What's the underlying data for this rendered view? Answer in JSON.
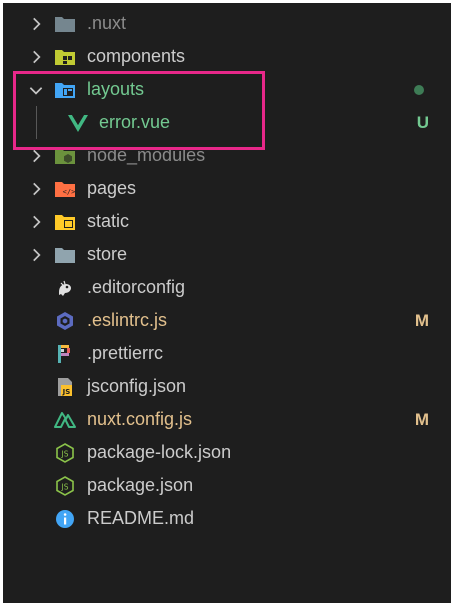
{
  "explorer": {
    "items": [
      {
        "name": ".nuxt",
        "type": "folder",
        "icon": "folder-icon",
        "dim": true
      },
      {
        "name": "components",
        "type": "folder",
        "icon": "components-folder-icon"
      },
      {
        "name": "layouts",
        "type": "folder",
        "icon": "layouts-folder-icon",
        "expanded": true,
        "status": "dot"
      },
      {
        "name": "error.vue",
        "type": "file",
        "icon": "vue-icon",
        "status": "U"
      },
      {
        "name": "node_modules",
        "type": "folder",
        "icon": "node-folder-icon",
        "dim": true
      },
      {
        "name": "pages",
        "type": "folder",
        "icon": "pages-folder-icon"
      },
      {
        "name": "static",
        "type": "folder",
        "icon": "static-folder-icon"
      },
      {
        "name": "store",
        "type": "folder",
        "icon": "folder-icon"
      },
      {
        "name": ".editorconfig",
        "type": "file",
        "icon": "editorconfig-icon"
      },
      {
        "name": ".eslintrc.js",
        "type": "file",
        "icon": "eslint-icon",
        "status": "M"
      },
      {
        "name": ".prettierrc",
        "type": "file",
        "icon": "prettier-icon"
      },
      {
        "name": "jsconfig.json",
        "type": "file",
        "icon": "js-config-icon"
      },
      {
        "name": "nuxt.config.js",
        "type": "file",
        "icon": "nuxt-icon",
        "status": "M"
      },
      {
        "name": "package-lock.json",
        "type": "file",
        "icon": "nodejs-icon"
      },
      {
        "name": "package.json",
        "type": "file",
        "icon": "nodejs-icon"
      },
      {
        "name": "README.md",
        "type": "file",
        "icon": "info-icon"
      }
    ]
  },
  "colors": {
    "background": "#1e1e1e",
    "modified": "#e2c08d",
    "untracked": "#73c991",
    "highlight_border": "#e8288a"
  }
}
